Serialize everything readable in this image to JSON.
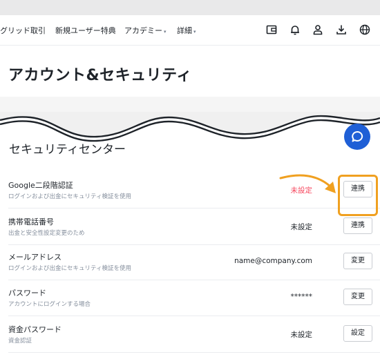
{
  "nav": {
    "items": [
      {
        "label": "グリッド取引",
        "has_caret": false
      },
      {
        "label": "新規ユーザー特典",
        "has_caret": false
      },
      {
        "label": "アカデミー",
        "has_caret": true
      },
      {
        "label": "詳細",
        "has_caret": true
      }
    ],
    "caret": "▾",
    "icons": [
      "wallet-icon",
      "bell-icon",
      "user-icon",
      "download-icon",
      "globe-icon"
    ]
  },
  "page": {
    "title": "アカウント&セキュリティ",
    "section_title": "セキュリティセンター"
  },
  "chat": {
    "icon": "chat-bubble-icon"
  },
  "security_items": [
    {
      "title": "Google二段階認証",
      "description": "ログインおよび出金にセキュリティ検証を使用",
      "status": "未設定",
      "status_color": "#f6465d",
      "button": "連携",
      "highlighted": true
    },
    {
      "title": "携帯電話番号",
      "description": "出金と安全性設定変更のため",
      "status": "未設定",
      "status_color": "#1e2329",
      "button": "連携",
      "highlighted": false
    },
    {
      "title": "メールアドレス",
      "description": "ログインおよび出金にセキュリティ検証を使用",
      "status": "name@company.com",
      "status_color": "#1e2329",
      "button": "変更",
      "highlighted": false
    },
    {
      "title": "パスワード",
      "description": "アカウントにログインする場合",
      "status": "******",
      "status_color": "#1e2329",
      "button": "変更",
      "highlighted": false
    },
    {
      "title": "資金パスワード",
      "description": "資金認証",
      "status": "未設定",
      "status_color": "#1e2329",
      "button": "設定",
      "highlighted": false
    }
  ],
  "colors": {
    "accent": "#f0a020",
    "chat": "#1f5fd6",
    "warning": "#f6465d"
  }
}
